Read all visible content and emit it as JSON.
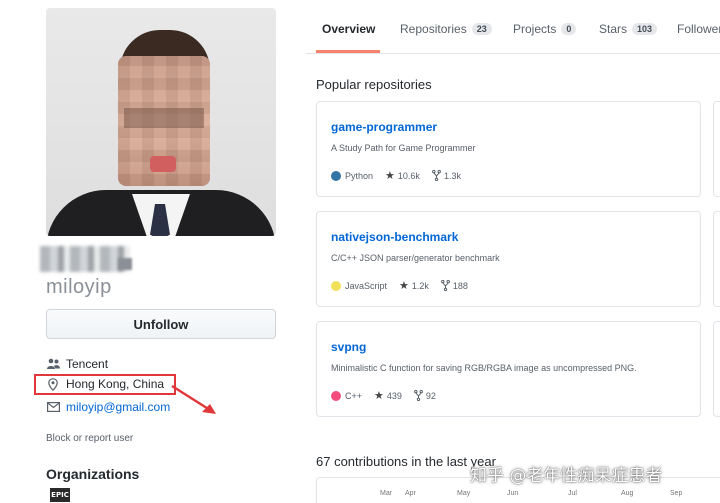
{
  "profile": {
    "username": "miloyip",
    "follow_button": "Unfollow",
    "company": "Tencent",
    "location": "Hong Kong, China",
    "email": "miloyip@gmail.com",
    "block_link": "Block or report user",
    "organizations_heading": "Organizations",
    "org_logo_text": "EPIC"
  },
  "tabs": [
    {
      "label": "Overview",
      "count": null,
      "active": true
    },
    {
      "label": "Repositories",
      "count": "23"
    },
    {
      "label": "Projects",
      "count": "0"
    },
    {
      "label": "Stars",
      "count": "103"
    },
    {
      "label": "Follower",
      "count": null
    }
  ],
  "popular": {
    "heading": "Popular repositories",
    "repos": [
      {
        "name": "game-programmer",
        "description": "A Study Path for Game Programmer",
        "language": "Python",
        "lang_color": "#3572A5",
        "stars": "10.6k",
        "forks": "1.3k"
      },
      {
        "name": "nativejson-benchmark",
        "description": "C/C++ JSON parser/generator benchmark",
        "language": "JavaScript",
        "lang_color": "#f1e05a",
        "stars": "1.2k",
        "forks": "188"
      },
      {
        "name": "svpng",
        "description": "Minimalistic C function for saving RGB/RGBA image as uncompressed PNG.",
        "language": "C++",
        "lang_color": "#f34b7d",
        "stars": "439",
        "forks": "92"
      }
    ]
  },
  "contributions": {
    "heading": "67 contributions in the last year",
    "months": [
      "Mar",
      "Apr",
      "May",
      "Jun",
      "Jul",
      "Aug",
      "Sep"
    ]
  },
  "watermark": "知乎 @老年性痴呆症患者",
  "colors": {
    "accent_underline": "#f9826c",
    "link": "#0366d6",
    "highlight_box": "#e0383a"
  },
  "icons": {
    "org": "people-icon",
    "location": "location-pin-icon",
    "email": "mail-icon",
    "star": "star-icon",
    "fork": "fork-icon"
  }
}
